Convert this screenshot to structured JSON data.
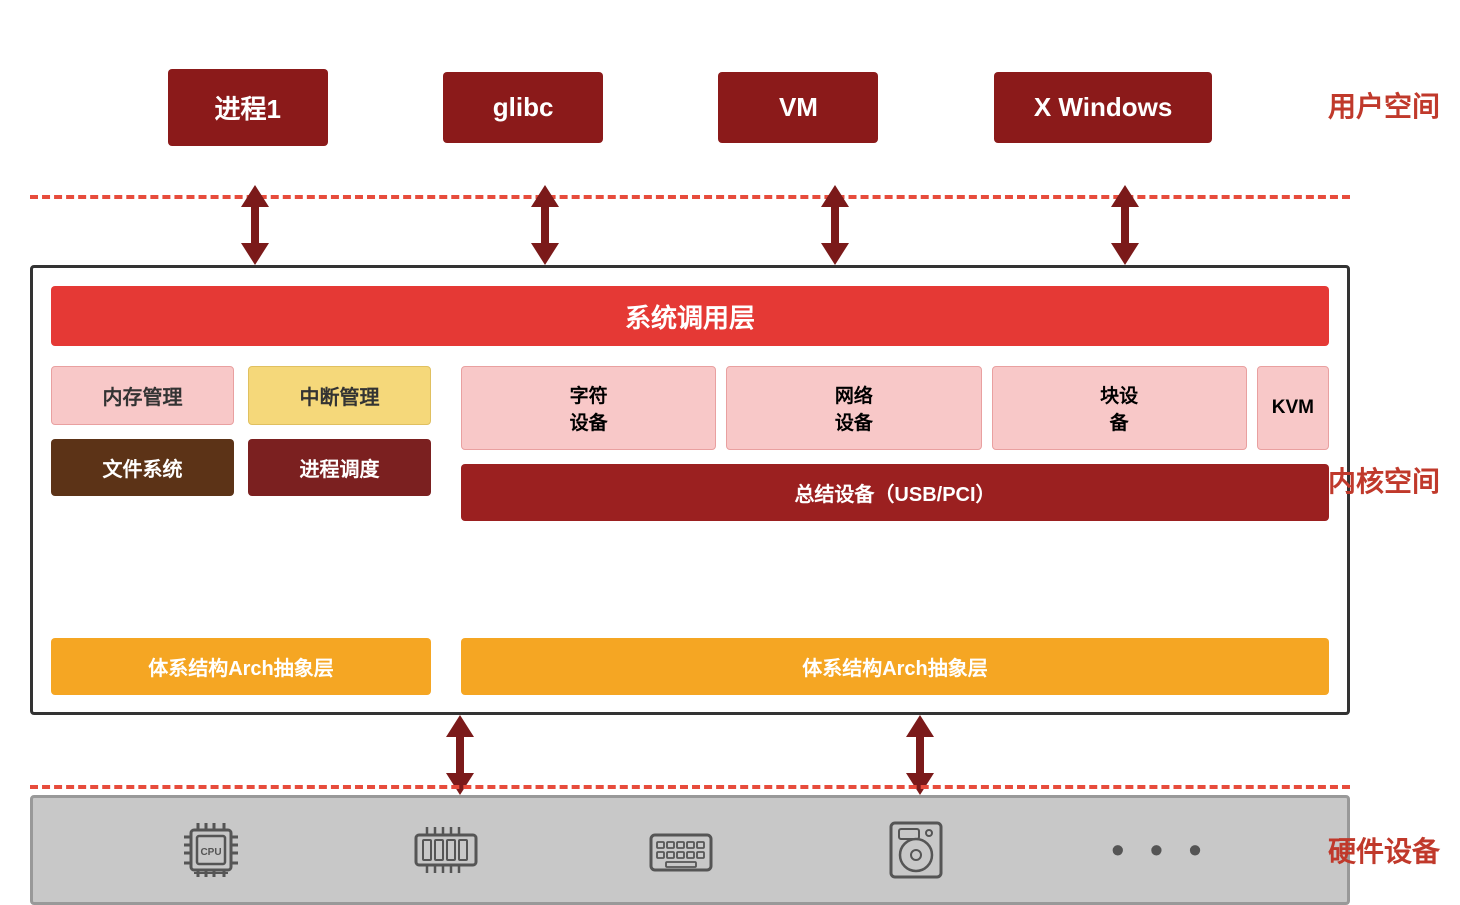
{
  "zones": {
    "user_label": "用户空间",
    "kernel_label": "内核空间",
    "hw_label": "硬件设备"
  },
  "user_boxes": [
    "进程1",
    "glibc",
    "VM",
    "X Windows"
  ],
  "syscall": "系统调用层",
  "kernel_cells": {
    "mem_mgmt": "内存管理",
    "interrupt": "中断管理",
    "filesystem": "文件系统",
    "proc_sched": "进程调度",
    "char_dev": "字符\n设备",
    "net_dev": "网络\n设备",
    "blk_dev": "块设\n备",
    "kvm": "KVM",
    "bus_dev": "总结设备（USB/PCI）",
    "arch_left": "体系结构Arch抽象层",
    "arch_right": "体系结构Arch抽象层"
  },
  "hw_icons": [
    "cpu",
    "memory",
    "keyboard",
    "disk",
    "more"
  ]
}
